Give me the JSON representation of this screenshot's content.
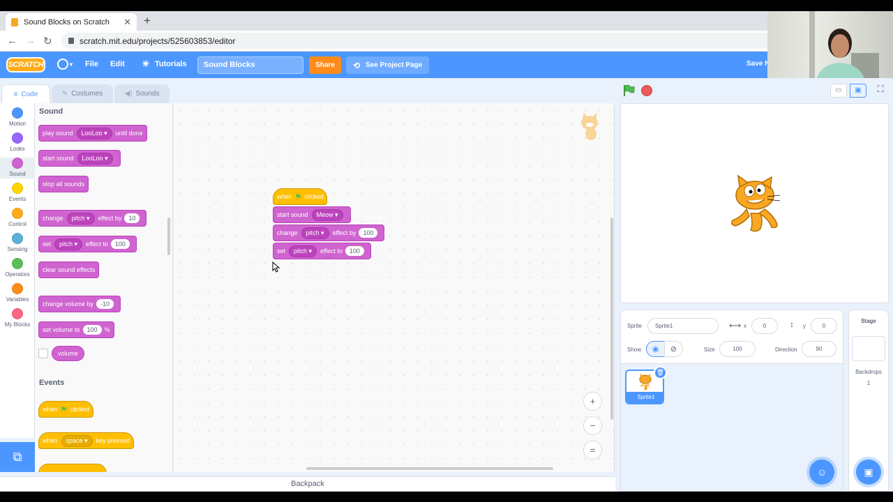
{
  "browser": {
    "tab_title": "Sound Blocks on Scratch",
    "tab_close": "✕",
    "new_tab": "+",
    "url": "scratch.mit.edu/projects/525603853/editor"
  },
  "menu": {
    "logo": "SCRATCH",
    "file": "File",
    "edit": "Edit",
    "tutorials": "Tutorials",
    "project_title": "Sound Blocks",
    "share": "Share",
    "see_project_page": "See Project Page",
    "save_now": "Save N"
  },
  "tabs": {
    "code": "Code",
    "costumes": "Costumes",
    "sounds": "Sounds"
  },
  "categories": [
    {
      "label": "Motion",
      "color": "#4c97ff"
    },
    {
      "label": "Looks",
      "color": "#9966ff"
    },
    {
      "label": "Sound",
      "color": "#cf63cf"
    },
    {
      "label": "Events",
      "color": "#ffd500"
    },
    {
      "label": "Control",
      "color": "#ffab19"
    },
    {
      "label": "Sensing",
      "color": "#5cb1d6"
    },
    {
      "label": "Operators",
      "color": "#59c059"
    },
    {
      "label": "Variables",
      "color": "#ff8c1a"
    },
    {
      "label": "My Blocks",
      "color": "#ff6680"
    }
  ],
  "palette": {
    "sound_heading": "Sound",
    "events_heading": "Events",
    "play_sound": "play sound",
    "play_sound_value": "LooLoo",
    "until_done": "until done",
    "start_sound": "start sound",
    "start_sound_value": "LooLoo",
    "stop_all_sounds": "stop all sounds",
    "change": "change",
    "pitch": "pitch",
    "effect_by": "effect by",
    "change_value": "10",
    "set": "set",
    "effect_to": "effect to",
    "set_value": "100",
    "clear_sound_effects": "clear sound effects",
    "change_volume_by": "change volume by",
    "change_volume_value": "-10",
    "set_volume_to": "set volume to",
    "set_volume_value": "100",
    "percent": "%",
    "volume": "volume",
    "when": "when",
    "clicked": "clicked",
    "space": "space",
    "key_pressed": "key pressed"
  },
  "script": {
    "when": "when",
    "clicked": "clicked",
    "start_sound": "start sound",
    "sound_value": "Meow",
    "change": "change",
    "pitch": "pitch",
    "effect_by": "effect by",
    "change_value": "100",
    "set": "set",
    "effect_to": "effect to",
    "set_value": "100"
  },
  "backpack": "Backpack",
  "sprite_info": {
    "sprite_label": "Sprite",
    "sprite_name": "Sprite1",
    "x_label": "x",
    "x_value": "0",
    "y_label": "y",
    "y_value": "0",
    "show_label": "Show",
    "size_label": "Size",
    "size_value": "100",
    "direction_label": "Direction",
    "direction_value": "90"
  },
  "sprite_tile": {
    "name": "Sprite1"
  },
  "stage_panel": {
    "title": "Stage",
    "backdrops_label": "Backdrops",
    "backdrops_count": "1"
  },
  "zoom": {
    "in": "+",
    "out": "−",
    "reset": "="
  }
}
